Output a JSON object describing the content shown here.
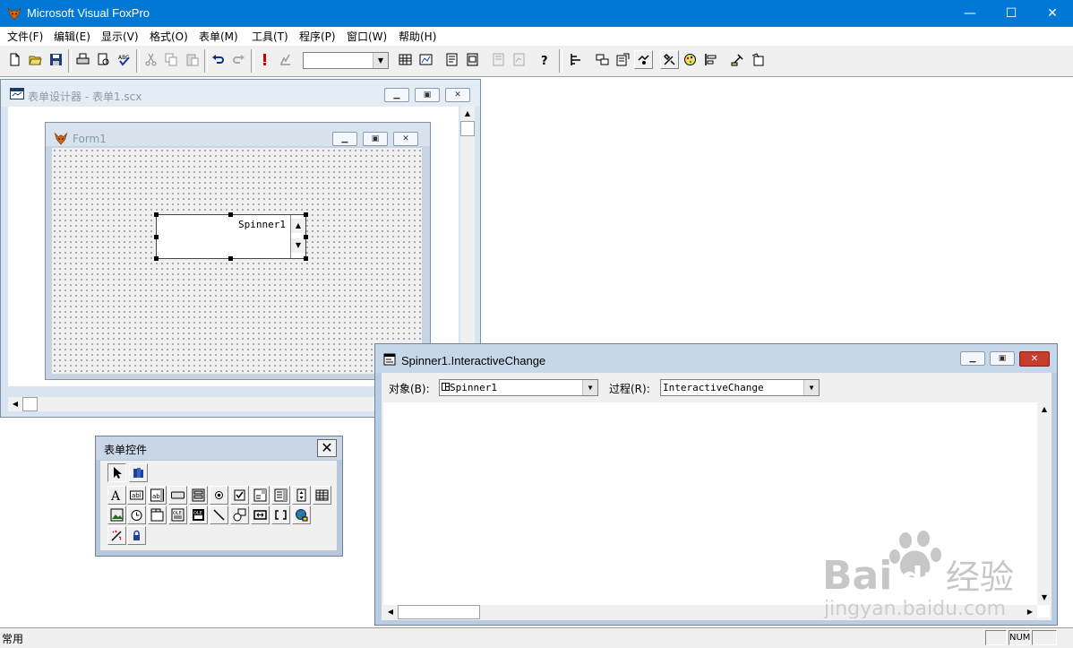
{
  "app": {
    "title": "Microsoft Visual FoxPro",
    "controls": {
      "minimize": "—",
      "maximize": "☐",
      "close": "✕"
    }
  },
  "menu": {
    "items": [
      "文件(F)",
      "编辑(E)",
      "显示(V)",
      "格式(O)",
      "表单(M)",
      "工具(T)",
      "程序(P)",
      "窗口(W)",
      "帮助(H)"
    ]
  },
  "toolbar": {
    "buttons": [
      "new",
      "open",
      "save",
      "print",
      "print-preview",
      "spell-check",
      "cut",
      "copy",
      "paste",
      "undo",
      "redo",
      "run",
      "modify-form",
      "database",
      "form-wizard",
      "report-wizard",
      "label-wizard",
      "query-wizard",
      "help",
      "form-designer",
      "data-environment",
      "properties",
      "code",
      "form-controls-toolbar",
      "color-palette",
      "layout",
      "form-builder",
      "auto-format"
    ],
    "combo_value": ""
  },
  "form_designer": {
    "title": "表单设计器 - 表单1.scx"
  },
  "form1": {
    "title": "Form1",
    "spinner_text": "Spinner1"
  },
  "form_controls": {
    "title": "表单控件",
    "close": "✕",
    "tools": [
      "select-objects",
      "view-classes",
      "label",
      "text-box",
      "edit-box",
      "command-button",
      "command-group",
      "option-group",
      "check-box",
      "combo-box",
      "list-box",
      "spinner",
      "grid",
      "image",
      "timer",
      "page-frame",
      "oleconnect",
      "olebound",
      "line",
      "shape",
      "container",
      "separator",
      "hyperlink",
      "builder-lock",
      "button-lock"
    ]
  },
  "code_window": {
    "title": "Spinner1.InteractiveChange",
    "object_label": "对象(B):",
    "object_value": "Spinner1",
    "procedure_label": "过程(R):",
    "procedure_value": "InteractiveChange",
    "code": ""
  },
  "statusbar": {
    "text": "常用",
    "num": "NUM"
  },
  "watermark": {
    "brand": "Baidu经验",
    "url": "jingyan.baidu.com"
  },
  "colors": {
    "titlebar": "#0078d7",
    "window_frame": "#b9cde2",
    "code_close": "#c83c2c"
  }
}
